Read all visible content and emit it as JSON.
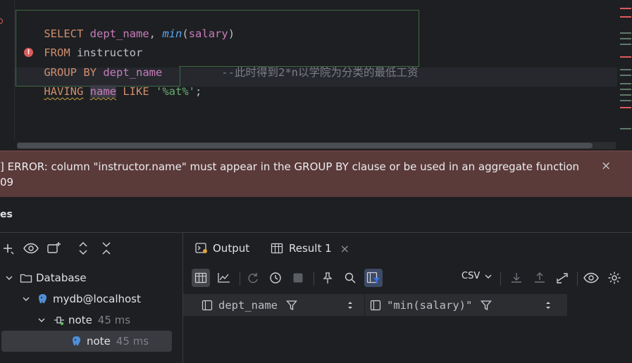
{
  "editor": {
    "line1": {
      "kw": "SELECT",
      "col": "dept_name",
      "comma": ",",
      "fn": "min",
      "paren_open": "(",
      "arg": "salary",
      "paren_close": ")"
    },
    "line2": {
      "kw": "FROM",
      "table": "instructor"
    },
    "line3": {
      "kw": "GROUP BY",
      "col": "dept_name",
      "comment": "--此时得到2*n以学院为分类的最低工资"
    },
    "line4": {
      "kw": "HAVING",
      "col": "name",
      "like": "LIKE",
      "str": "'%at%'",
      "semi": ";"
    },
    "error_glyph": "!"
  },
  "error_banner": {
    "message": "] ERROR: column \"instructor.name\" must appear in the GROUP BY clause or be used in an aggregate function",
    "code": "09",
    "close": "×"
  },
  "services": {
    "title": "es",
    "tree": [
      {
        "label": "Database",
        "meta": ""
      },
      {
        "label": "mydb@localhost",
        "meta": ""
      },
      {
        "label": "note",
        "meta": "45 ms"
      },
      {
        "label": "note",
        "meta": "45 ms"
      }
    ]
  },
  "results": {
    "tabs": [
      {
        "label": "Output"
      },
      {
        "label": "Result 1",
        "close": "×"
      }
    ],
    "export_format": "CSV",
    "columns": [
      {
        "label": "dept_name"
      },
      {
        "label": "\"min(salary)\""
      }
    ]
  },
  "colors": {
    "accent": "#3574f0",
    "error_bg": "#5b3a3a",
    "editor_bg": "#1e1f22"
  }
}
